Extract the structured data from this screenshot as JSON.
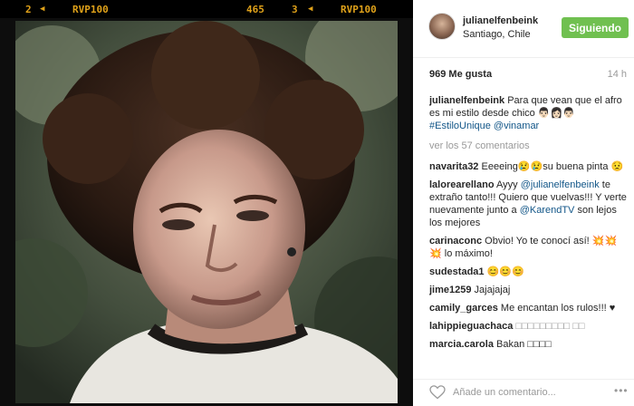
{
  "film": {
    "frame_a": "2",
    "brand_a": "RVP100",
    "counter": "465",
    "frame_b": "3",
    "brand_b": "RVP100",
    "accent": "#e0a21a"
  },
  "post": {
    "username": "julianelfenbeink",
    "location": "Santiago, Chile",
    "follow_label": "Siguiendo",
    "likes": "969 Me gusta",
    "time": "14 h",
    "caption": {
      "user": "julianelfenbeink",
      "text": "Para que vean que el afro es mi estilo desde chico 👨🏻👩🏻👨🏻",
      "tags": "#EstiloUnique @vinamar"
    },
    "view_all": "ver los 57 comentarios"
  },
  "comments": [
    {
      "user": "navarita32",
      "text": "Eeeeing😢😢su buena pinta 😟"
    },
    {
      "user": "lalorearellano",
      "text": "Ayyy ",
      "mention": "@julianelfenbeink",
      "text2": " te extraño tanto!!! Quiero que vuelvas!!! Y verte nuevamente junto a ",
      "mention2": "@KarendTV",
      "text3": " son lejos los mejores"
    },
    {
      "user": "carinaconc",
      "text": "Obvio! Yo te conocí así! 💥💥 💥 lo máximo!"
    },
    {
      "user": "sudestada1",
      "text": "😊😊😊"
    },
    {
      "user": "jime1259",
      "text": "Jajajajaj"
    },
    {
      "user": "camily_garces",
      "text": "Me encantan los rulos!!! ♥"
    },
    {
      "user": "lahippieguachaca",
      "text": "□□□□□□□□□ □□"
    },
    {
      "user": "marcia.carola",
      "text": "Bakan □□□□"
    }
  ],
  "composer": {
    "placeholder": "Añade un comentario...",
    "more": "•••"
  },
  "icons": [
    "heart-icon",
    "more-options-icon",
    "user-avatar"
  ],
  "colors": {
    "follow_green": "#70c050",
    "link_blue": "#125688",
    "muted_gray": "#999999"
  }
}
